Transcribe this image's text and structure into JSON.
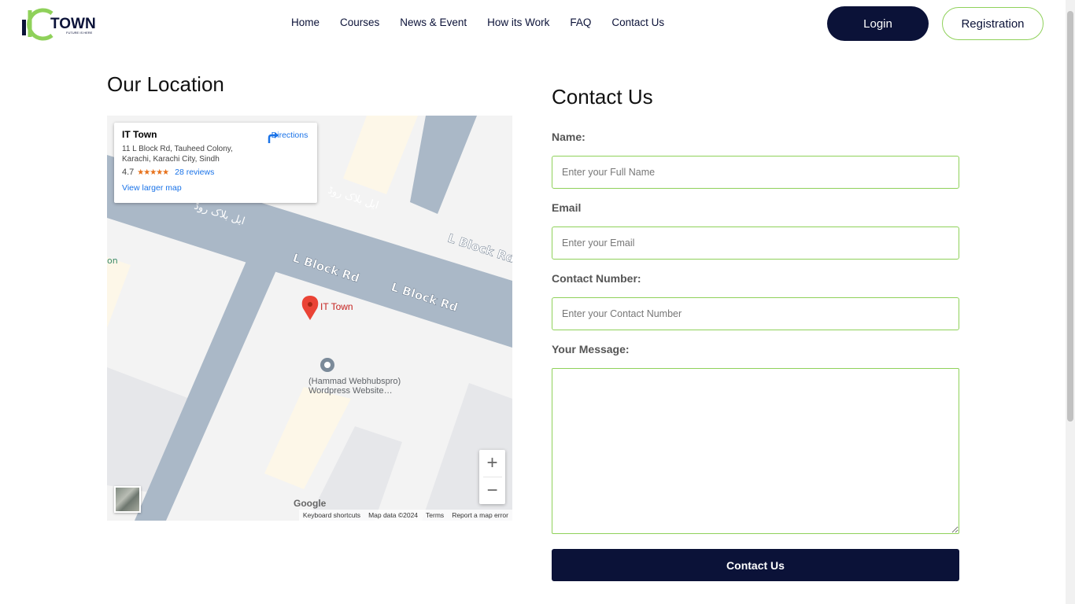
{
  "logo": {
    "text": "TOWN",
    "tagline": "FUTURE IS HERE"
  },
  "nav": {
    "items": [
      "Home",
      "Courses",
      "News & Event",
      "How its Work",
      "FAQ",
      "Contact Us"
    ]
  },
  "header_buttons": {
    "login": "Login",
    "registration": "Registration"
  },
  "location": {
    "title": "Our Location",
    "map": {
      "place_name": "IT Town",
      "address": "11 L Block Rd, Tauheed Colony, Karachi, Karachi City, Sindh",
      "rating": "4.7",
      "stars": "★★★★★",
      "reviews": "28 reviews",
      "view_larger": "View larger map",
      "directions": "Directions",
      "pin_label": "IT Town",
      "poi_label_1": "(Hammad Webhubspro)",
      "poi_label_2": "Wordpress Website…",
      "road_en": "L Block Rd",
      "road_ur": "ایل بلاک روڈ",
      "partial_label": "on",
      "zoom_in": "+",
      "zoom_out": "−",
      "google": "Google",
      "footer": [
        "Keyboard shortcuts",
        "Map data ©2024",
        "Terms",
        "Report a map error"
      ]
    }
  },
  "contact": {
    "title": "Contact Us",
    "name_label": "Name:",
    "name_placeholder": "Enter your Full Name",
    "email_label": "Email",
    "email_placeholder": "Enter your Email",
    "phone_label": "Contact Number:",
    "phone_placeholder": "Enter your Contact Number",
    "message_label": "Your Message:",
    "submit": "Contact Us"
  },
  "colors": {
    "navy": "#0b1238",
    "green": "#8fd15a",
    "road": "#aab8c7"
  }
}
